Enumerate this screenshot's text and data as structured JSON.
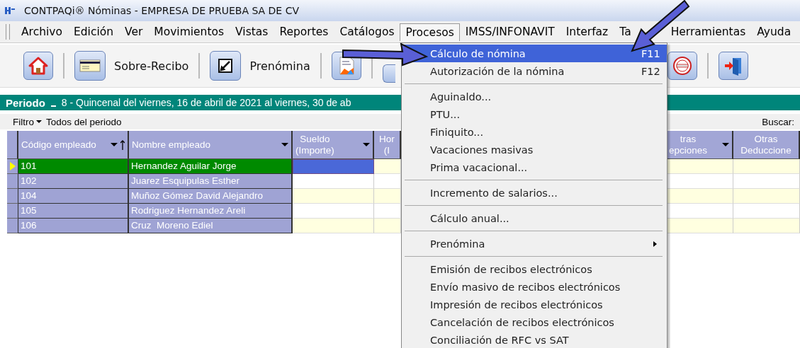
{
  "window": {
    "title": "CONTPAQi® Nóminas - EMPRESA DE PRUEBA SA DE CV"
  },
  "menu_bar": [
    {
      "label": "Archivo",
      "selected": false
    },
    {
      "label": "Edición",
      "selected": false
    },
    {
      "label": "Ver",
      "selected": false
    },
    {
      "label": "Movimientos",
      "selected": false
    },
    {
      "label": "Vistas",
      "selected": false
    },
    {
      "label": "Reportes",
      "selected": false
    },
    {
      "label": "Catálogos",
      "selected": false
    },
    {
      "label": "Procesos",
      "selected": true
    },
    {
      "label": "IMSS/INFONAVIT",
      "selected": false
    },
    {
      "label": "Interfaz",
      "selected": false
    },
    {
      "label": "Ta",
      "selected": false
    },
    {
      "label": "Herramientas",
      "selected": false
    },
    {
      "label": "Ayuda",
      "selected": false
    }
  ],
  "toolbar": [
    {
      "kind": "home"
    },
    {
      "kind": "envelope",
      "label": "Sobre-Recibo"
    },
    {
      "kind": "edit",
      "label": "Prenómina"
    },
    {
      "kind": "report"
    },
    {
      "kind": "partial"
    },
    {
      "kind": "stamp"
    },
    {
      "kind": "exit"
    }
  ],
  "period": {
    "label": "Periodo",
    "value": "8 - Quincenal del viernes, 16 de abril de 2021 al viernes, 30 de ab"
  },
  "filter": {
    "label": "Filtro",
    "value": "Todos del periodo",
    "search_label": "Buscar:"
  },
  "table": {
    "columns": [
      {
        "lines": [
          "Código empleado"
        ],
        "menu": true,
        "sorted": true
      },
      {
        "lines": [
          "Nombre empleado"
        ],
        "menu": true,
        "sorted": false
      },
      {
        "lines": [
          "Sueldo",
          "(Importe)"
        ],
        "menu": true,
        "sorted": false
      },
      {
        "lines": [
          "Hor",
          "(I"
        ],
        "menu": false,
        "sorted": false
      },
      {
        "lines": [
          "tras",
          "epciones"
        ],
        "menu": true,
        "sorted": false
      },
      {
        "lines": [
          "Otras",
          "Deduccione"
        ],
        "menu": false,
        "sorted": false
      }
    ],
    "rows": [
      {
        "code": "101",
        "name": "Hernandez Aguilar Jorge",
        "selected": true
      },
      {
        "code": "102",
        "name": "Juarez Esquipulas Esther",
        "selected": false
      },
      {
        "code": "104",
        "name": "Muñoz Gómez David Alejandro",
        "selected": false
      },
      {
        "code": "105",
        "name": "Rodriguez Hernandez Areli",
        "selected": false
      },
      {
        "code": "106",
        "name": "Cruz  Moreno Ediel",
        "selected": false
      }
    ]
  },
  "dropdown": [
    {
      "kind": "item",
      "label": "Cálculo de nómina",
      "shortcut": "F11",
      "selected": true
    },
    {
      "kind": "item",
      "label": "Autorización de la nómina",
      "shortcut": "F12",
      "selected": false
    },
    {
      "kind": "separator"
    },
    {
      "kind": "item",
      "label": "Aguinaldo...",
      "selected": false
    },
    {
      "kind": "item",
      "label": "PTU...",
      "selected": false
    },
    {
      "kind": "item",
      "label": "Finiquito...",
      "selected": false
    },
    {
      "kind": "item",
      "label": "Vacaciones masivas",
      "selected": false
    },
    {
      "kind": "item",
      "label": "Prima vacacional...",
      "selected": false
    },
    {
      "kind": "separator"
    },
    {
      "kind": "item",
      "label": "Incremento de salarios...",
      "selected": false
    },
    {
      "kind": "separator"
    },
    {
      "kind": "item",
      "label": "Cálculo anual...",
      "selected": false
    },
    {
      "kind": "separator"
    },
    {
      "kind": "submenu",
      "label": "Prenómina",
      "selected": false
    },
    {
      "kind": "separator"
    },
    {
      "kind": "item",
      "label": "Emisión de recibos electrónicos",
      "selected": false
    },
    {
      "kind": "item",
      "label": "Envío masivo de recibos electrónicos",
      "selected": false
    },
    {
      "kind": "item",
      "label": "Impresión de recibos electrónicos",
      "selected": false
    },
    {
      "kind": "item",
      "label": "Cancelación de recibos electrónicos",
      "selected": false
    },
    {
      "kind": "item",
      "label": "Conciliación de RFC vs SAT",
      "selected": false
    }
  ]
}
